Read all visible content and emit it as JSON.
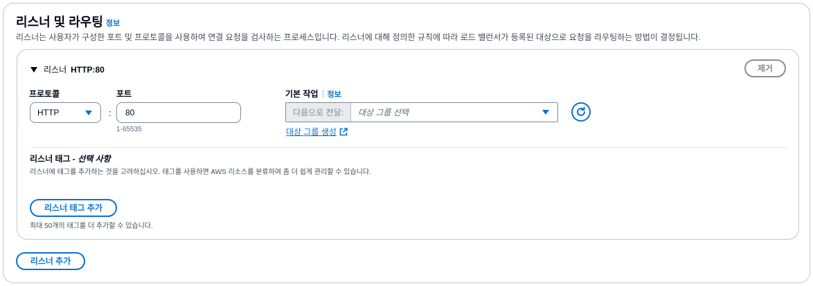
{
  "header": {
    "title": "리스너 및 라우팅",
    "info": "정보",
    "description": "리스너는 사용자가 구성한 포트 및 프로토콜을 사용하여 연결 요청을 검사하는 프로세스입니다. 리스너에 대해 정의한 규칙에 따라 로드 밸런서가 등록된 대상으로 요청을 라우팅하는 방법이 결정됩니다."
  },
  "listener": {
    "label": "리스너",
    "value": "HTTP:80",
    "remove_label": "제거",
    "protocol": {
      "label": "프로토콜",
      "value": "HTTP"
    },
    "colon": ":",
    "port": {
      "label": "포트",
      "value": "80",
      "hint": "1-65535"
    },
    "default_action": {
      "label": "기본 작업",
      "info": "정보",
      "prefix": "다음으로 전달:",
      "placeholder": "대상 그룹 선택",
      "create_link": "대상 그룹 생성"
    },
    "tags": {
      "title": "리스너 태그 - ",
      "title_optional": "선택 사항",
      "description": "리스너에 태그를 추가하는 것을 고려하십시오. 태그를 사용하면 AWS 리소스를 분류하여 좀 더 쉽게 관리할 수 있습니다.",
      "add_label": "리스너 태그 추가",
      "limit": "최대 50개의 태그를 더 추가할 수 있습니다."
    }
  },
  "add_listener_label": "리스너 추가",
  "icons": {
    "expand": "caret-down-icon",
    "dropdown": "triangle-down-icon",
    "refresh": "refresh-icon",
    "external": "external-link-icon"
  },
  "colors": {
    "link": "#0972d3",
    "text": "#000716",
    "border": "#7d8998",
    "disabled": "#8c8c94"
  }
}
